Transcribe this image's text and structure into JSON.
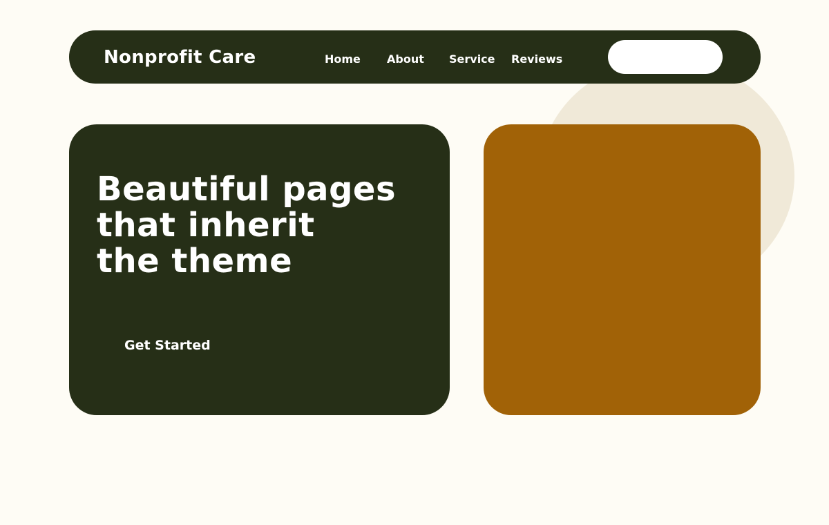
{
  "brand": {
    "name": "Nonprofit Care"
  },
  "nav": {
    "items": [
      {
        "label": "Home"
      },
      {
        "label": "About"
      },
      {
        "label": "Service"
      },
      {
        "label": "Reviews"
      }
    ],
    "cta_label": ""
  },
  "hero": {
    "title_lines": [
      "Beautiful pages",
      "that inherit",
      "the theme"
    ],
    "cta_label": "Get Started"
  },
  "colors": {
    "background": "#fefcf5",
    "dark": "#262f17",
    "accent": "#a16207",
    "circle": "#f0e9d8",
    "text_light": "#ffffff"
  }
}
